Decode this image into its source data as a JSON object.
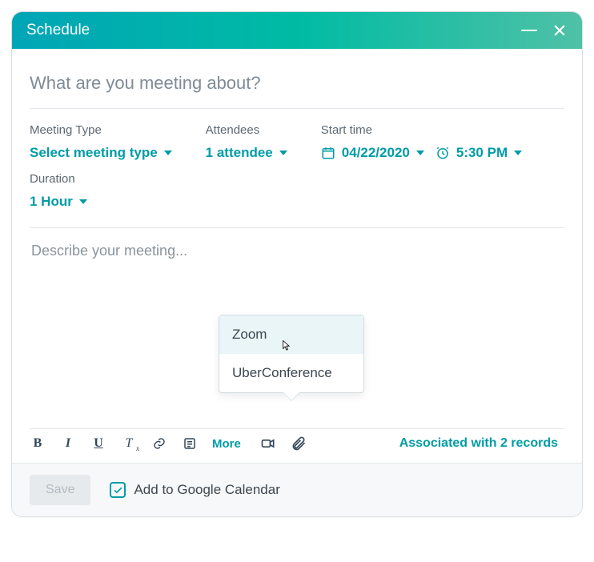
{
  "titlebar": {
    "title": "Schedule"
  },
  "subject": {
    "placeholder": "What are you meeting about?"
  },
  "fields": {
    "meeting_type": {
      "label": "Meeting Type",
      "value": "Select meeting type"
    },
    "attendees": {
      "label": "Attendees",
      "value": "1 attendee"
    },
    "start_time": {
      "label": "Start time",
      "date": "04/22/2020",
      "time": "5:30 PM"
    },
    "duration": {
      "label": "Duration",
      "value": "1 Hour"
    }
  },
  "editor": {
    "placeholder": "Describe your meeting..."
  },
  "popup": {
    "items": [
      "Zoom",
      "UberConference"
    ],
    "hovered_index": 0
  },
  "toolbar": {
    "more_label": "More",
    "associated_label": "Associated with 2 records"
  },
  "footer": {
    "save_label": "Save",
    "add_to_gcal_label": "Add to Google Calendar",
    "add_to_gcal_checked": true
  },
  "colors": {
    "accent": "#009ca6"
  }
}
